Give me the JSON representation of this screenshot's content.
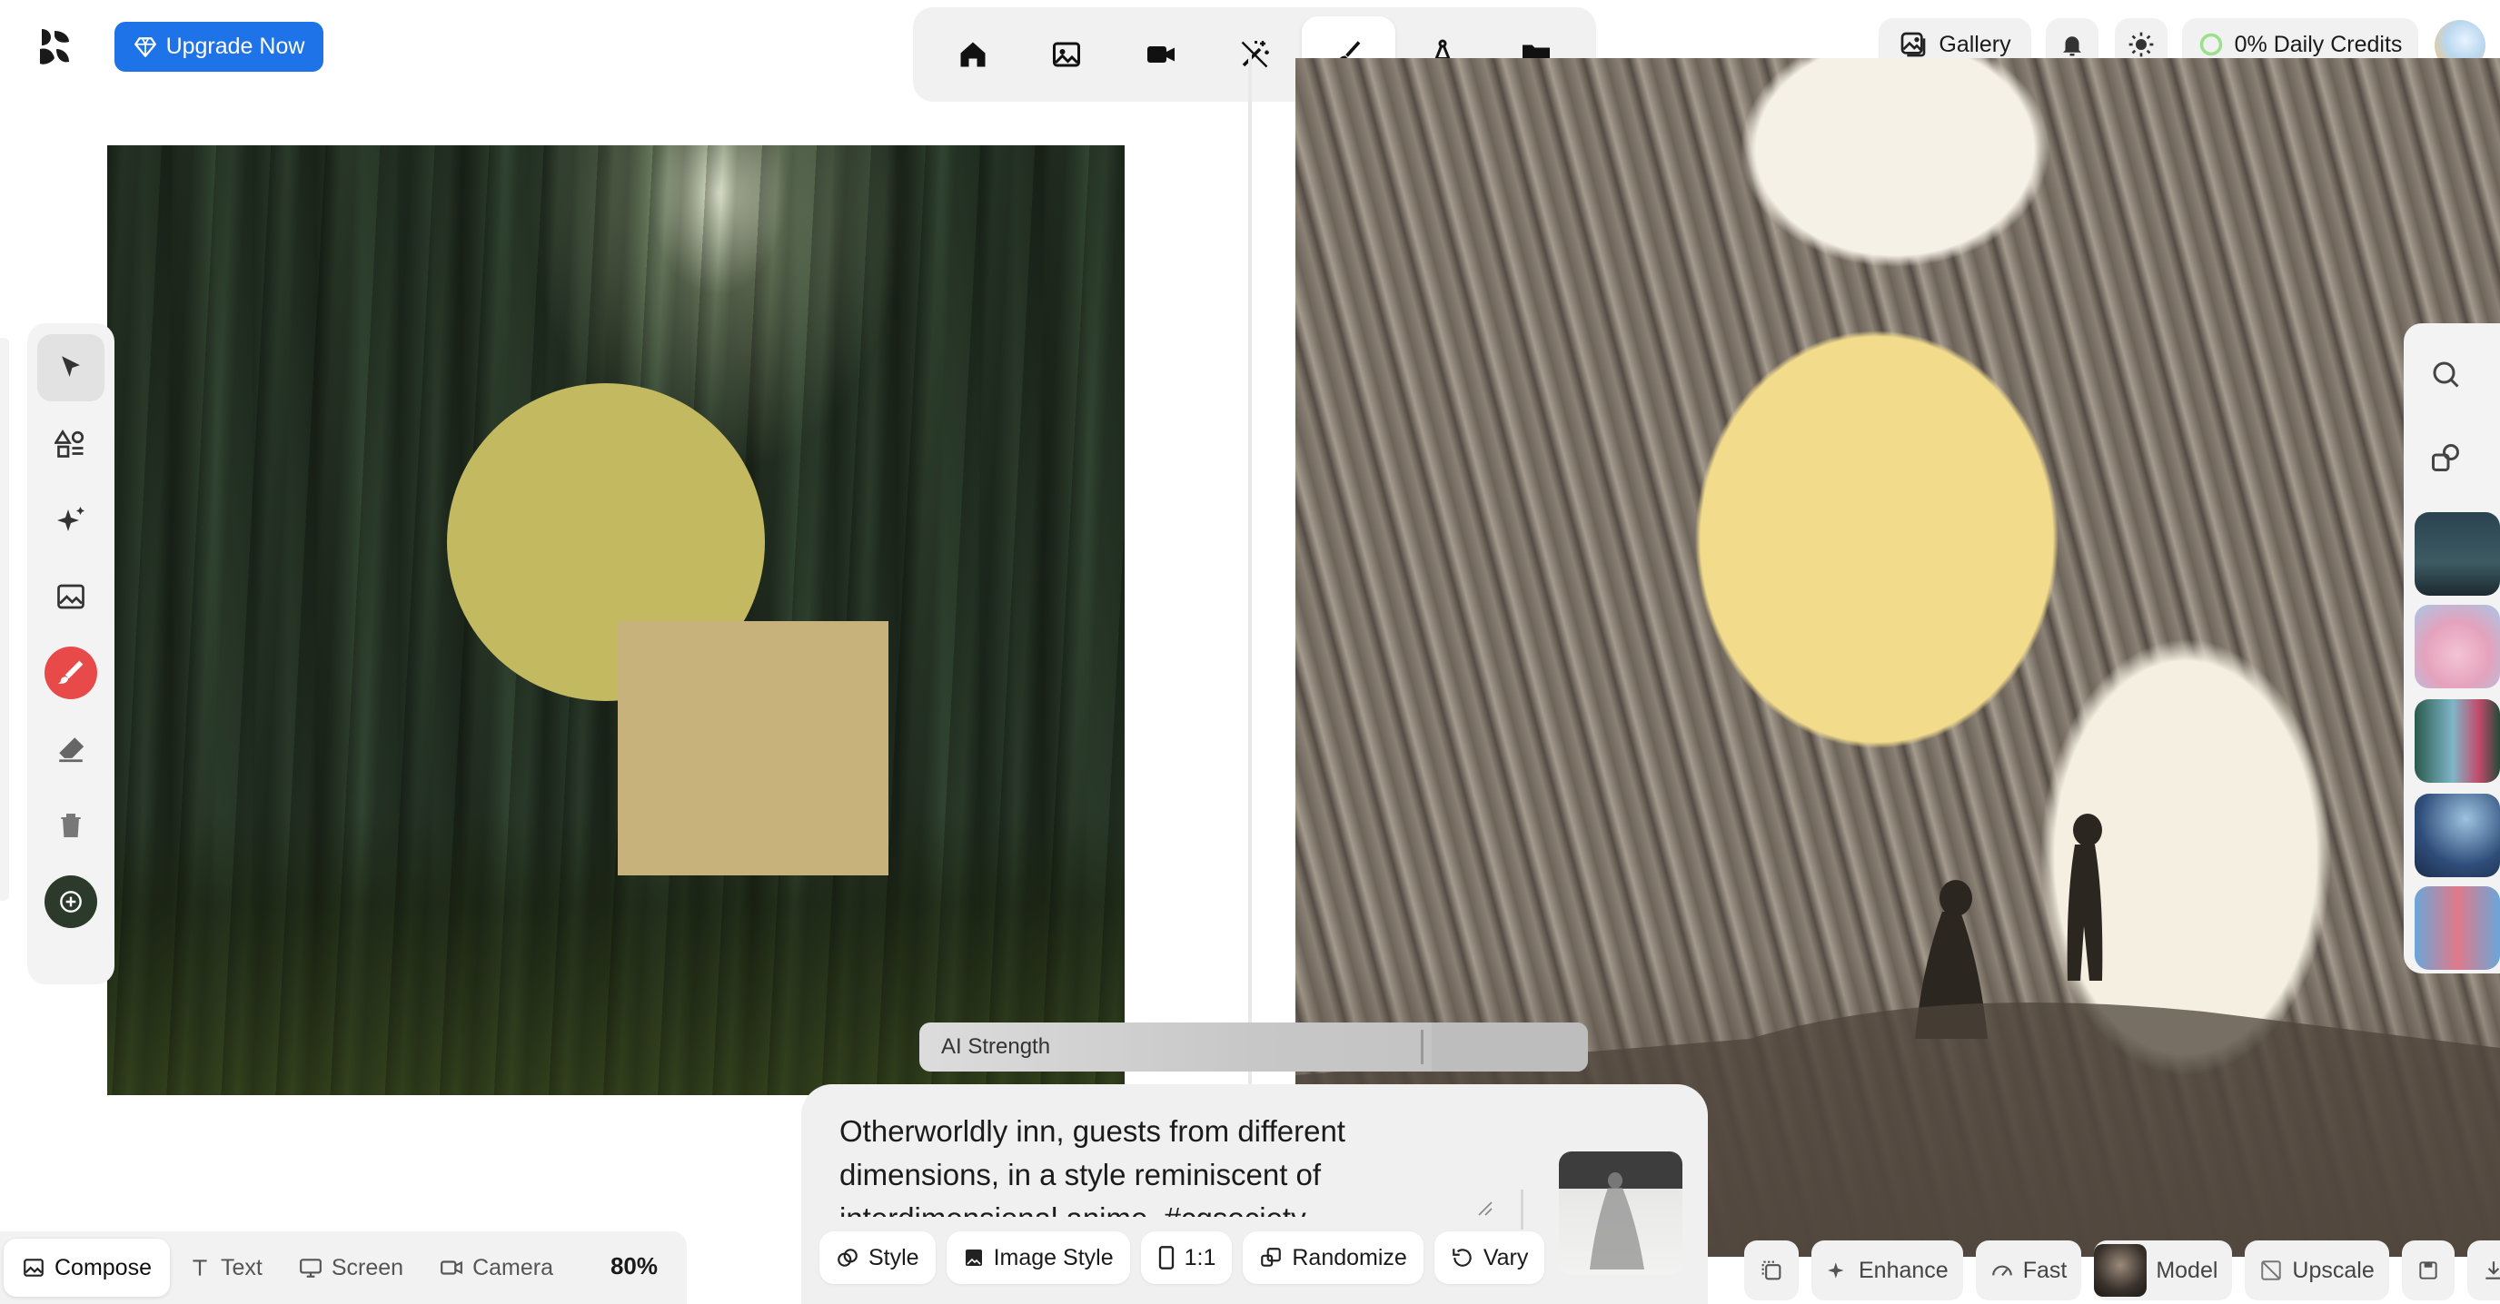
{
  "header": {
    "upgrade_label": "Upgrade Now",
    "gallery_label": "Gallery",
    "credits_label": "0% Daily Credits"
  },
  "top_modes": [
    {
      "icon": "home-icon"
    },
    {
      "icon": "image-icon"
    },
    {
      "icon": "video-icon"
    },
    {
      "icon": "magic-wand-icon"
    },
    {
      "icon": "brush-icon",
      "active": true
    },
    {
      "icon": "compass-icon"
    },
    {
      "icon": "folder-icon"
    }
  ],
  "left_tools": [
    {
      "icon": "pointer-icon",
      "selected": true
    },
    {
      "icon": "shapes-icon"
    },
    {
      "icon": "sparkles-icon"
    },
    {
      "icon": "image-add-icon"
    },
    {
      "icon": "brush-color-icon",
      "color": "#e84a4a"
    },
    {
      "icon": "eraser-icon"
    },
    {
      "icon": "trash-icon"
    },
    {
      "icon": "layer-icon"
    }
  ],
  "canvas": {
    "circle_color": "#c3b960",
    "square_color": "#c6b27a"
  },
  "bottom_left": {
    "modes": [
      "Compose",
      "Text",
      "Screen",
      "Camera"
    ],
    "active_mode": "Compose",
    "zoom": "80%"
  },
  "ai_strength": {
    "label": "AI Strength",
    "value_fraction": 0.75
  },
  "prompt": {
    "text": "Otherworldly inn, guests from different dimensions, in a style reminiscent of interdimensional anime, #cgsociety"
  },
  "prompt_chips": [
    {
      "label": "Style",
      "icon": "palette-icon"
    },
    {
      "label": "Image Style",
      "icon": "image-style-icon"
    },
    {
      "label": "1:1",
      "icon": "aspect-ratio-icon"
    },
    {
      "label": "Randomize",
      "icon": "dice-icon"
    },
    {
      "label": "Vary",
      "icon": "refresh-icon"
    }
  ],
  "bottom_right": {
    "enhance_label": "Enhance",
    "fast_label": "Fast",
    "model_label": "Model",
    "upscale_label": "Upscale"
  },
  "colors": {
    "accent": "#1f73e8",
    "toolbar_bg": "#f1f1f1"
  }
}
